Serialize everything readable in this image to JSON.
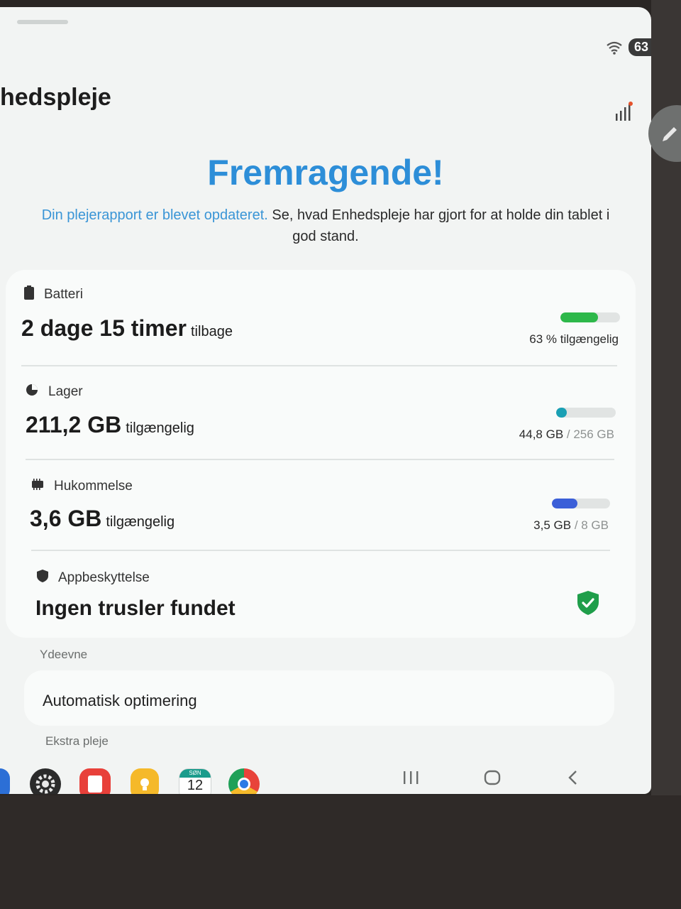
{
  "status_bar": {
    "battery": "63"
  },
  "header": {
    "title": "hedspleje"
  },
  "hero": {
    "title": "Fremragende!",
    "desc_link": "Din plejerapport er blevet opdateret.",
    "desc_text": "Se, hvad Enhedspleje har gjort for at holde din tablet i god stand."
  },
  "battery": {
    "label": "Batteri",
    "value": "2 dage 15 timer",
    "value_suffix": "tilbage",
    "caption": "63 % tilgængelig",
    "level": 0.63,
    "color": "#2db84a"
  },
  "storage": {
    "label": "Lager",
    "value": "211,2 GB",
    "value_suffix": "tilgængelig",
    "used": "44,8 GB",
    "total": "/ 256 GB",
    "level": 0.175,
    "color": "#1aa0b4"
  },
  "memory": {
    "label": "Hukommelse",
    "value": "3,6 GB",
    "value_suffix": "tilgængelig",
    "used": "3,5 GB",
    "total": "/ 8 GB",
    "level": 0.44,
    "color": "#3b5fd8"
  },
  "app_protection": {
    "label": "Appbeskyttelse",
    "value": "Ingen trusler fundet",
    "color": "#1f9e4a"
  },
  "performance": {
    "header": "Ydeevne",
    "auto_optimize": "Automatisk optimering"
  },
  "extra_care": {
    "header": "Ekstra pleje"
  },
  "taskbar": {
    "calendar_day": "SØN",
    "calendar_date": "12",
    "apps": [
      "settings-icon",
      "notes-icon",
      "keep-icon",
      "calendar-icon",
      "chrome-icon"
    ]
  },
  "colors": {
    "accent": "#2d8ed8",
    "background": "#f2f4f3"
  }
}
